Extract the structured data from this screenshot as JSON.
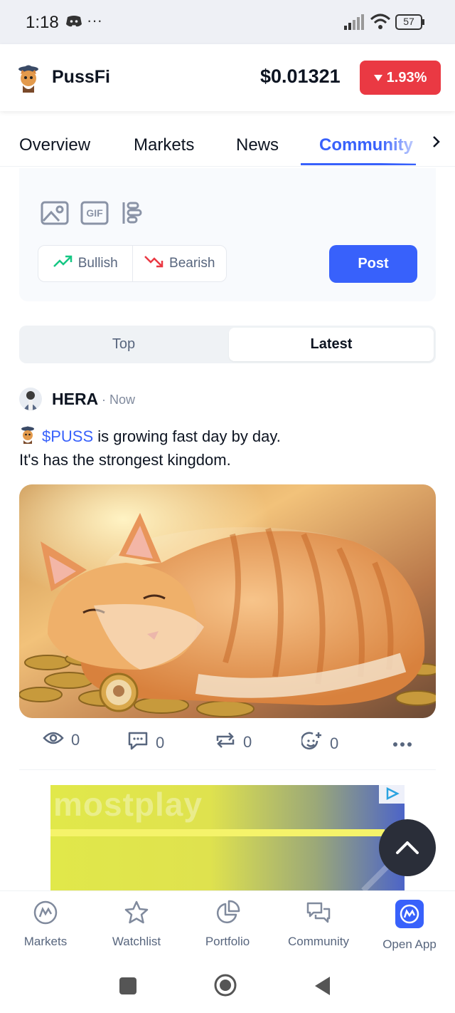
{
  "status_bar": {
    "time": "1:18",
    "more": "···",
    "battery": "57"
  },
  "header": {
    "coin_name": "PussFi",
    "price": "$0.01321",
    "change": "1.93%",
    "change_direction": "down",
    "change_color": "#ea3943"
  },
  "tabs": [
    {
      "label": "Overview"
    },
    {
      "label": "Markets"
    },
    {
      "label": "News"
    },
    {
      "label": "Community"
    }
  ],
  "composer": {
    "tools": [
      "image-icon",
      "gif-icon",
      "poll-icon"
    ],
    "gif_label": "GIF",
    "bullish_label": "Bullish",
    "bearish_label": "Bearish",
    "post_label": "Post"
  },
  "feed_toggle": {
    "top": "Top",
    "latest": "Latest",
    "selected": "Latest"
  },
  "post": {
    "author": "HERA",
    "time": "· Now",
    "cashtag": "$PUSS",
    "text_line1": " is growing fast day by day.",
    "text_line2": "It's has the strongest kingdom.",
    "views": "0",
    "comments": "0",
    "reposts": "0",
    "reactions": "0"
  },
  "ad": {
    "brand": "mostplay"
  },
  "bottom_nav": [
    {
      "label": "Markets"
    },
    {
      "label": "Watchlist"
    },
    {
      "label": "Portfolio"
    },
    {
      "label": "Community"
    },
    {
      "label": "Open App"
    }
  ],
  "colors": {
    "accent": "#3861fb",
    "bullish": "#16c784",
    "bearish": "#ea3943"
  }
}
